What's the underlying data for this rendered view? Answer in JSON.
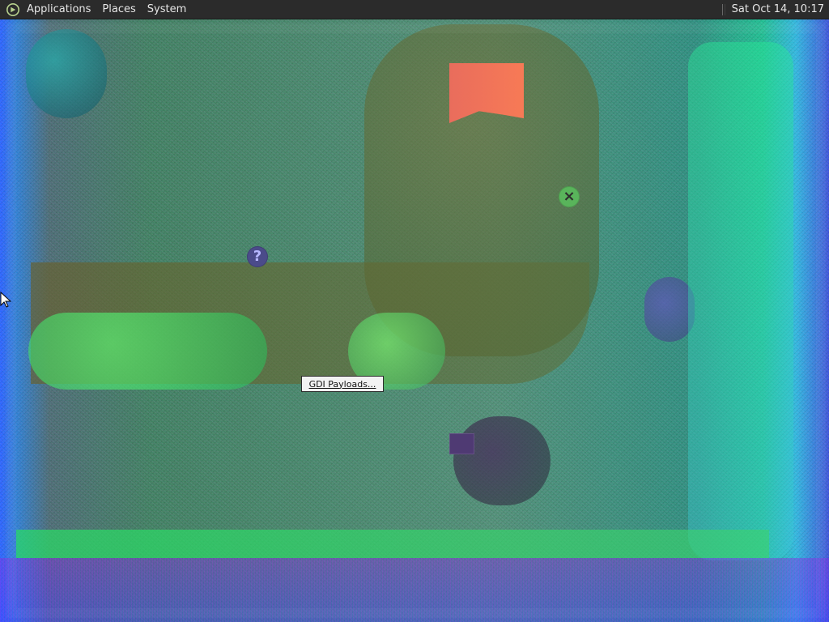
{
  "top_panel": {
    "menu": [
      "Applications",
      "Places",
      "System"
    ],
    "clock": "Sat Oct 14, 10:17"
  },
  "desktop": {
    "dialog_button_label": "GDI Payloads...",
    "icons": {
      "help": "question-mark",
      "close": "close-x"
    }
  },
  "colors": {
    "panel_bg": "#2b2b2b",
    "panel_text": "#e6e6e6",
    "accent_red": "#f06c5d",
    "accent_green": "#59b45b",
    "accent_purple": "#4b4b8a"
  }
}
